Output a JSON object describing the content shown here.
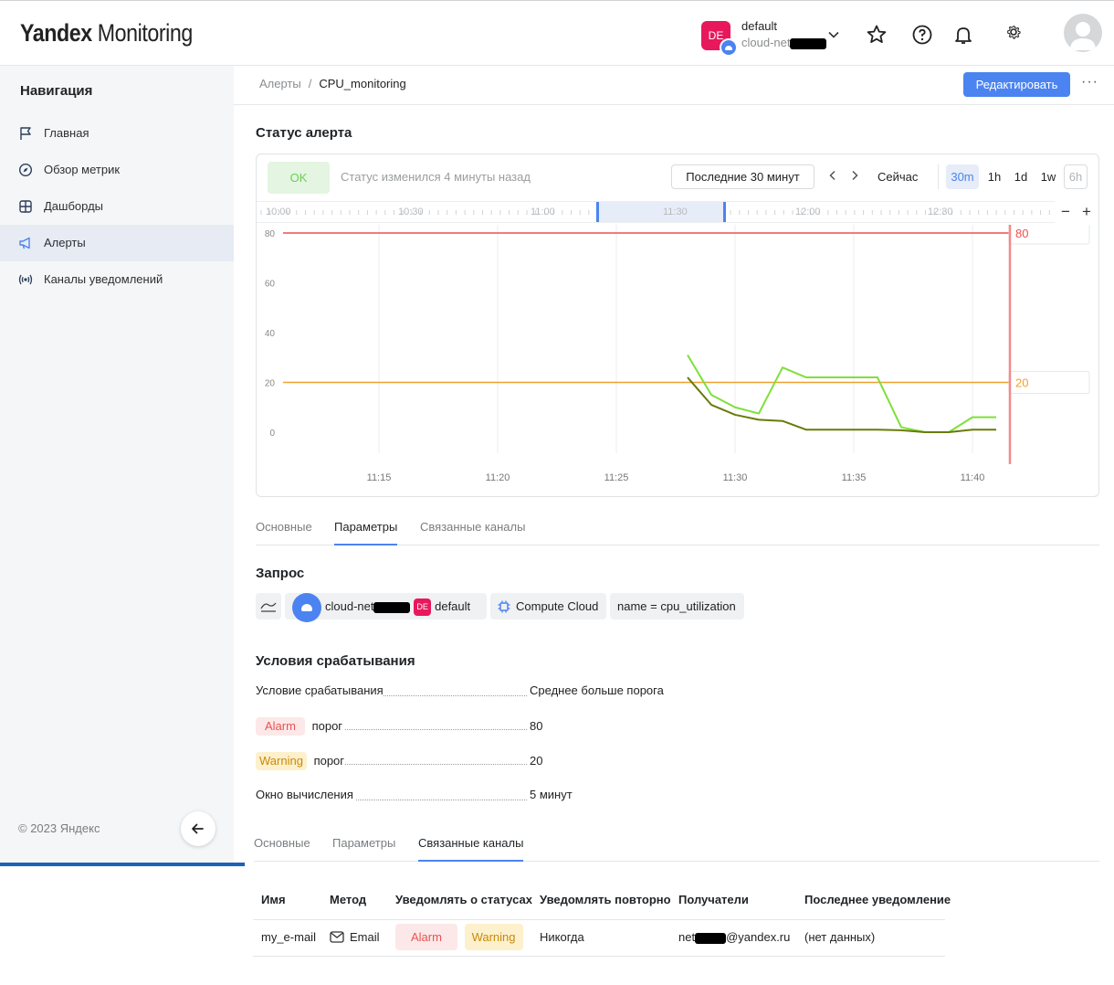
{
  "header": {
    "logo_bold": "Yandex",
    "logo_rest": " Monitoring",
    "project_avatar": "DE",
    "project_name": "default",
    "project_cloud": "cloud-net"
  },
  "sidebar": {
    "title": "Навигация",
    "items": [
      {
        "label": "Главная",
        "icon": "flag-icon"
      },
      {
        "label": "Обзор метрик",
        "icon": "compass-icon"
      },
      {
        "label": "Дашборды",
        "icon": "dashboard-grid-icon"
      },
      {
        "label": "Алерты",
        "icon": "megaphone-icon",
        "active": true
      },
      {
        "label": "Каналы уведомлений",
        "icon": "broadcast-icon"
      }
    ],
    "copyright": "© 2023 Яндекс"
  },
  "breadcrumb": {
    "parent": "Алерты",
    "separator": "/",
    "current": "CPU_monitoring"
  },
  "toolbar": {
    "edit_label": "Редактировать",
    "more_label": "···"
  },
  "alert_status": {
    "title": "Статус алерта",
    "status": "OK",
    "status_changed": "Статус изменился 4 минуты назад",
    "range_label": "Последние 30 минут",
    "now_label": "Сейчас",
    "zoom_options": [
      "30m",
      "1h",
      "1d",
      "1w",
      "6h"
    ],
    "zoom_selected": "30m",
    "timeline_labels": [
      "10:00",
      "10:30",
      "11:00",
      "11:30",
      "12:00",
      "12:30"
    ],
    "timeline_minus": "−",
    "timeline_plus": "+"
  },
  "chart_data": {
    "type": "line",
    "title": "",
    "xlabel": "",
    "ylabel": "",
    "x_ticks": [
      "11:15",
      "11:20",
      "11:25",
      "11:30",
      "11:35",
      "11:40"
    ],
    "y_ticks": [
      0,
      20,
      40,
      60,
      80
    ],
    "ylim": [
      0,
      85
    ],
    "xlim_minutes": [
      "11:11",
      "11:42"
    ],
    "grid": true,
    "thresholds": [
      {
        "value": 80,
        "label": "80",
        "color": "#e95252"
      },
      {
        "value": 20,
        "label": "20",
        "color": "#f0a030"
      }
    ],
    "series": [
      {
        "color": "#7ee03a",
        "x": [
          "11:28",
          "11:29",
          "11:30",
          "11:31",
          "11:32",
          "11:33",
          "11:34",
          "11:35",
          "11:36",
          "11:37",
          "11:38",
          "11:39",
          "11:40",
          "11:41"
        ],
        "values": [
          31,
          15,
          10,
          7.5,
          26,
          22,
          22,
          22,
          22,
          2,
          0,
          0,
          6,
          6
        ]
      },
      {
        "color": "#6b7a0a",
        "x": [
          "11:28",
          "11:29",
          "11:30",
          "11:31",
          "11:32",
          "11:33",
          "11:34",
          "11:35",
          "11:36",
          "11:37",
          "11:38",
          "11:39",
          "11:40",
          "11:41"
        ],
        "values": [
          22,
          11,
          7,
          5,
          4.5,
          1,
          1,
          1,
          1,
          0.8,
          0,
          0,
          1,
          1
        ]
      }
    ],
    "now_marker_color": "#f38a8a"
  },
  "tabs_top": [
    "Основные",
    "Параметры",
    "Связанные каналы"
  ],
  "tabs_top_active": 1,
  "query": {
    "title": "Запрос",
    "cloud": "cloud-net",
    "folder_avatar": "DE",
    "folder": "default",
    "service": "Compute Cloud",
    "selector": "name = cpu_utilization"
  },
  "conditions": {
    "title": "Условия срабатывания",
    "rows": [
      {
        "label": "Условие срабатывания",
        "value": "Среднее больше порога"
      },
      {
        "pill": "Alarm",
        "label": "порог",
        "value": "80"
      },
      {
        "pill": "Warning",
        "label": "порог",
        "value": "20"
      },
      {
        "label": "Окно вычисления",
        "value": "5 минут"
      }
    ]
  },
  "tabs_bottom": [
    "Основные",
    "Параметры",
    "Связанные каналы"
  ],
  "tabs_bottom_active": 2,
  "channels": {
    "columns": [
      "Имя",
      "Метод",
      "Уведомлять о статусах",
      "Уведомлять повторно",
      "Получатели",
      "Последнее уведомление"
    ],
    "rows": [
      {
        "name": "my_e-mail",
        "method": "Email",
        "statuses": [
          "Alarm",
          "Warning"
        ],
        "repeat": "Никогда",
        "recipient_prefix": "net",
        "recipient_suffix": "@yandex.ru",
        "last": "(нет данных)"
      }
    ]
  }
}
